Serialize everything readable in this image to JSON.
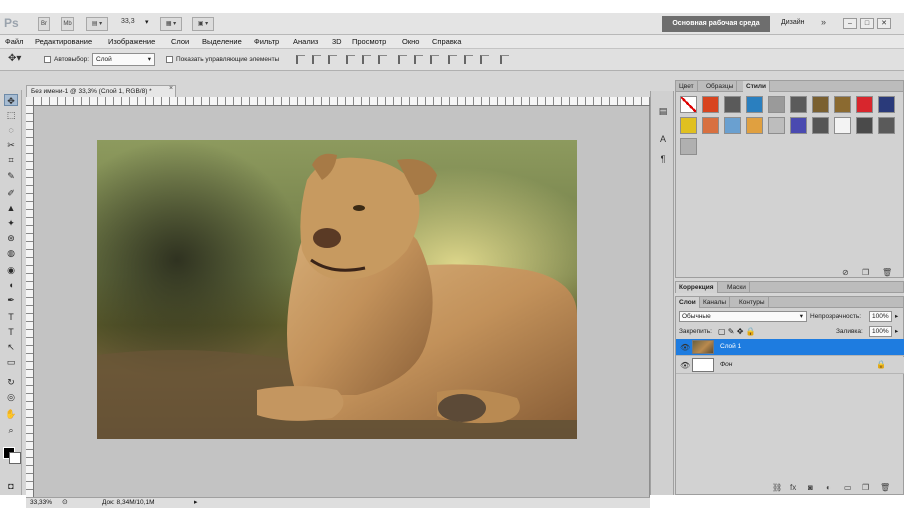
{
  "app": {
    "logo": "Ps",
    "bridge_label": "Br",
    "minibridge_label": "Mb",
    "zoom_value": "33,3",
    "workspace": "Основная рабочая среда",
    "design": "Дизайн",
    "more": "»",
    "window_buttons": [
      "–",
      "□",
      "✕"
    ]
  },
  "menu": [
    "Файл",
    "Редактирование",
    "Изображение",
    "Слои",
    "Выделение",
    "Фильтр",
    "Анализ",
    "3D",
    "Просмотр",
    "Окно",
    "Справка"
  ],
  "options": {
    "autoselect_label": "Автовыбор:",
    "autoselect_value": "Слой",
    "show_controls_label": "Показать управляющие элементы"
  },
  "tools": [
    "✥",
    "⬚",
    "◌",
    "✂",
    "⌗",
    "✎",
    "✐",
    "▲",
    "✦",
    "⊛",
    "◍",
    "◉",
    "◖",
    "✒",
    "T",
    "↖",
    "▭",
    "✋",
    "🔍"
  ],
  "document": {
    "tab_title": "Без имени-1 @ 33,3% (Слой 1, RGB/8) *",
    "close": "×",
    "status_zoom": "33,33%",
    "status_doc": "Док: 8,34M/10,1M"
  },
  "panels": {
    "top_tabs": [
      "Цвет",
      "Образцы",
      "Стили"
    ],
    "mid_tabs": [
      "Коррекция",
      "Маски"
    ],
    "layer_tabs": [
      "Слои",
      "Каналы",
      "Контуры"
    ],
    "blend_mode": "Обычные",
    "opacity_label": "Непрозрачность:",
    "opacity_value": "100%",
    "lock_label": "Закрепить:",
    "fill_label": "Заливка:",
    "fill_value": "100%",
    "layers": [
      {
        "name": "Слой 1",
        "selected": true
      },
      {
        "name": "Фон",
        "selected": false
      }
    ],
    "style_colors": [
      "#ffffff",
      "#d8441f",
      "#5a5a5a",
      "#2a7fbf",
      "#9a9a9a",
      "#5b5b5b",
      "#7a6030",
      "#8b6a30",
      "#d8262d",
      "#2a3a7a",
      "#e0c020",
      "#d87040",
      "#6aa0d0",
      "#e0a040",
      "#bdbdbd",
      "#4a4ab0",
      "#555555",
      "#f3f3f3",
      "#4a4a4a",
      "#5a5a5a",
      "#b0b0b0"
    ],
    "accent": "#1e7ce0"
  }
}
